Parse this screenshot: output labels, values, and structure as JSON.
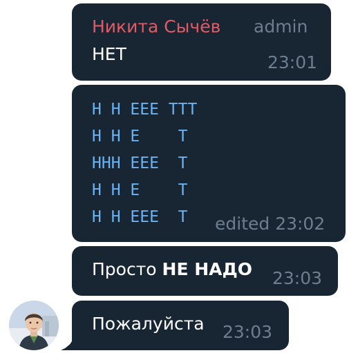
{
  "colors": {
    "bubble": "#182533",
    "sender_name": "#e35a67",
    "meta": "#6d7f8f",
    "text": "#ffffff",
    "code": "#6ab3f3"
  },
  "messages": [
    {
      "sender": "Никита Сычёв",
      "role": "admin",
      "text": "НЕТ",
      "time": "23:01"
    },
    {
      "code_lines": [
        "Н Н ЕЕЕ ТТТ",
        "Н Н Е    Т",
        "ННН ЕЕЕ  Т",
        "Н Н Е    Т",
        "Н Н ЕЕЕ  Т"
      ],
      "time": "edited 23:02"
    },
    {
      "text": "Просто",
      "bold_text": "НЕ НАДО",
      "time": "23:03"
    },
    {
      "text": "Пожалуйста",
      "time": "23:03",
      "avatar": "user-avatar-photo"
    }
  ]
}
